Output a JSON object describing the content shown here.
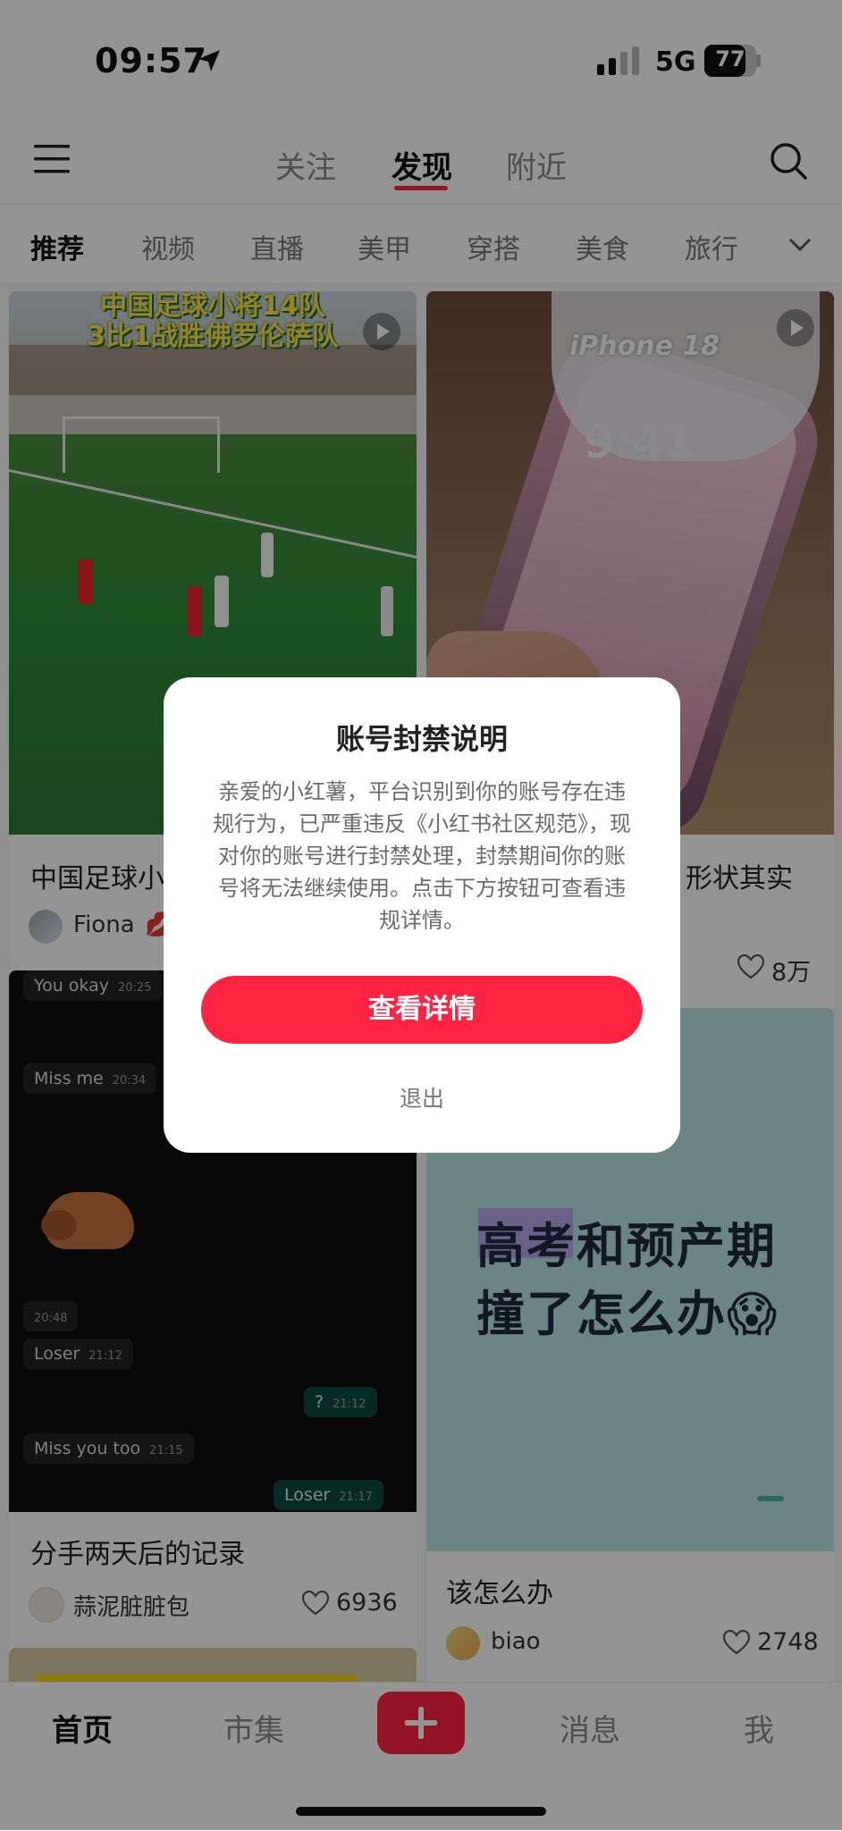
{
  "status_bar": {
    "time": "09:57",
    "network": "5G",
    "battery": "77"
  },
  "top_nav": {
    "tabs": [
      {
        "label": "关注"
      },
      {
        "label": "发现"
      },
      {
        "label": "附近"
      }
    ],
    "active_tab": "发现"
  },
  "categories": [
    "推荐",
    "视频",
    "直播",
    "美甲",
    "穿搭",
    "美食",
    "旅行"
  ],
  "feed": {
    "cards": [
      {
        "image_caption": "中国足球小将14队\n3比1战胜佛罗伦萨队",
        "title": "中国足球小",
        "author": "Fiona",
        "author_emoji": "💋"
      },
      {
        "image_caption": "iPhone 18",
        "screen_time": "9:41",
        "title": "形状其实",
        "likes": "8万"
      },
      {
        "title": "分手两天后的记录",
        "author": "蒜泥脏脏包",
        "likes": "6936",
        "messages": [
          {
            "text": "You okay",
            "time": "20:25"
          },
          {
            "text": "Miss me",
            "time": "20:34"
          },
          {
            "text": "",
            "time": "20:48"
          },
          {
            "text": "Loser",
            "time": "21:12"
          },
          {
            "text": "?",
            "time": "21:12"
          },
          {
            "text": "Miss you too",
            "time": "21:15"
          },
          {
            "text": "Loser",
            "time": "21:17"
          }
        ]
      },
      {
        "image_text_line1": "高考和预产期",
        "image_text_line2": "撞了怎么办😱",
        "title": "该怎么办",
        "author": "biao",
        "likes": "2748"
      }
    ]
  },
  "dialog": {
    "title": "账号封禁说明",
    "body": "亲爱的小红薯，平台识别到你的账号存在违规行为，已严重违反《小红书社区规范》，现对你的账号进行封禁处理，封禁期间你的账号将无法继续使用。点击下方按钮可查看违规详情。",
    "primary_button": "查看详情",
    "secondary_button": "退出"
  },
  "bottom_nav": {
    "home": "首页",
    "market": "市集",
    "messages": "消息",
    "me": "我"
  },
  "colors": {
    "accent": "#ff2442",
    "overlay": "rgba(0,0,0,0.42)"
  },
  "icons": [
    "location-arrow-icon",
    "signal-icon",
    "battery-icon",
    "menu-icon",
    "search-icon",
    "chevron-down-icon",
    "play-icon",
    "heart-icon",
    "plus-icon"
  ]
}
